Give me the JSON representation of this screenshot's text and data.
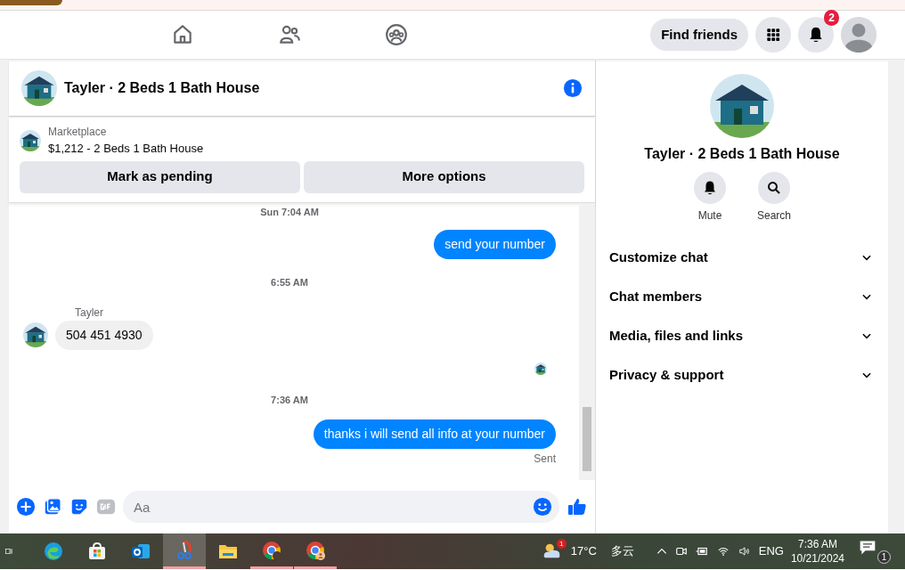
{
  "top_nav": {
    "tabs": [
      {
        "selected": false
      },
      {
        "selected": false
      },
      {
        "selected": false
      }
    ],
    "find_friends": "Find friends",
    "notification_count": "2"
  },
  "chat": {
    "title": "Tayler · 2 Beds 1 Bath House",
    "listing": {
      "source": "Marketplace",
      "item": "$1,212 - 2 Beds 1 Bath House",
      "buttons": [
        "Mark as pending",
        "More options"
      ]
    },
    "messages": [
      {
        "kind": "time",
        "text": "Sun 7:04 AM"
      },
      {
        "kind": "outgoing",
        "text": "send your number"
      },
      {
        "kind": "time",
        "text": "6:55 AM"
      },
      {
        "kind": "incoming",
        "sender": "Tayler",
        "text": "504 451 4930"
      },
      {
        "kind": "seen"
      },
      {
        "kind": "time",
        "text": "7:36 AM"
      },
      {
        "kind": "outgoing",
        "text": "thanks i will send all info at your number"
      },
      {
        "kind": "status",
        "text": "Sent"
      }
    ],
    "composer": {
      "placeholder": "Aa"
    }
  },
  "info_panel": {
    "title": "Tayler · 2 Beds 1 Bath House",
    "actions": [
      {
        "label": "Mute"
      },
      {
        "label": "Search"
      }
    ],
    "sections": [
      {
        "label": "Customize chat",
        "expanded": false
      },
      {
        "label": "Chat members",
        "expanded": false
      },
      {
        "label": "Media, files and links",
        "expanded": false
      },
      {
        "label": "Privacy & support",
        "expanded": false
      }
    ]
  },
  "taskbar": {
    "apps": [
      {
        "selected": false,
        "running": false
      },
      {
        "selected": false,
        "running": false
      },
      {
        "selected": false,
        "running": false
      },
      {
        "selected": true,
        "running": true
      },
      {
        "selected": false,
        "running": false
      },
      {
        "selected": false,
        "running": true
      },
      {
        "selected": false,
        "running": true
      }
    ],
    "weather_badge": "1",
    "temperature": "17°C",
    "weather": "多云",
    "language": "ENG",
    "time": "7:36 AM",
    "date": "10/21/2024",
    "notification_count": "1"
  }
}
